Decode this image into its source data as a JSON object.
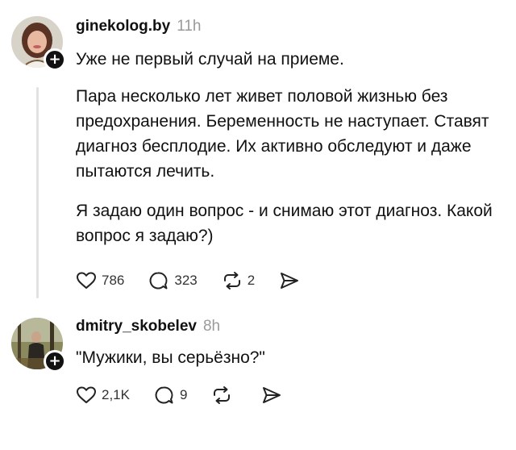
{
  "posts": [
    {
      "username": "ginekolog.by",
      "time": "11h",
      "paragraphs": [
        "Уже не первый случай на приеме.",
        "Пара несколько лет живет половой жизнью без предохранения. Беременность не наступает. Ставят диагноз бесплодие. Их активно обследуют и даже пытаются лечить.",
        "Я задаю один вопрос - и снимаю этот диагноз. Какой вопрос я задаю?)"
      ],
      "likes": "786",
      "comments": "323",
      "reposts": "2"
    },
    {
      "username": "dmitry_skobelev",
      "time": "8h",
      "paragraphs": [
        "\"Мужики, вы серьёзно?\""
      ],
      "likes": "2,1K",
      "comments": "9",
      "reposts": ""
    }
  ],
  "icons": {
    "follow": "plus-icon",
    "like": "heart-icon",
    "comment": "comment-bubble-icon",
    "repost": "repost-arrows-icon",
    "share": "send-icon"
  },
  "colors": {
    "text": "#111111",
    "muted": "#9a9a9a",
    "badge": "#111111"
  },
  "follow_symbol": "+"
}
